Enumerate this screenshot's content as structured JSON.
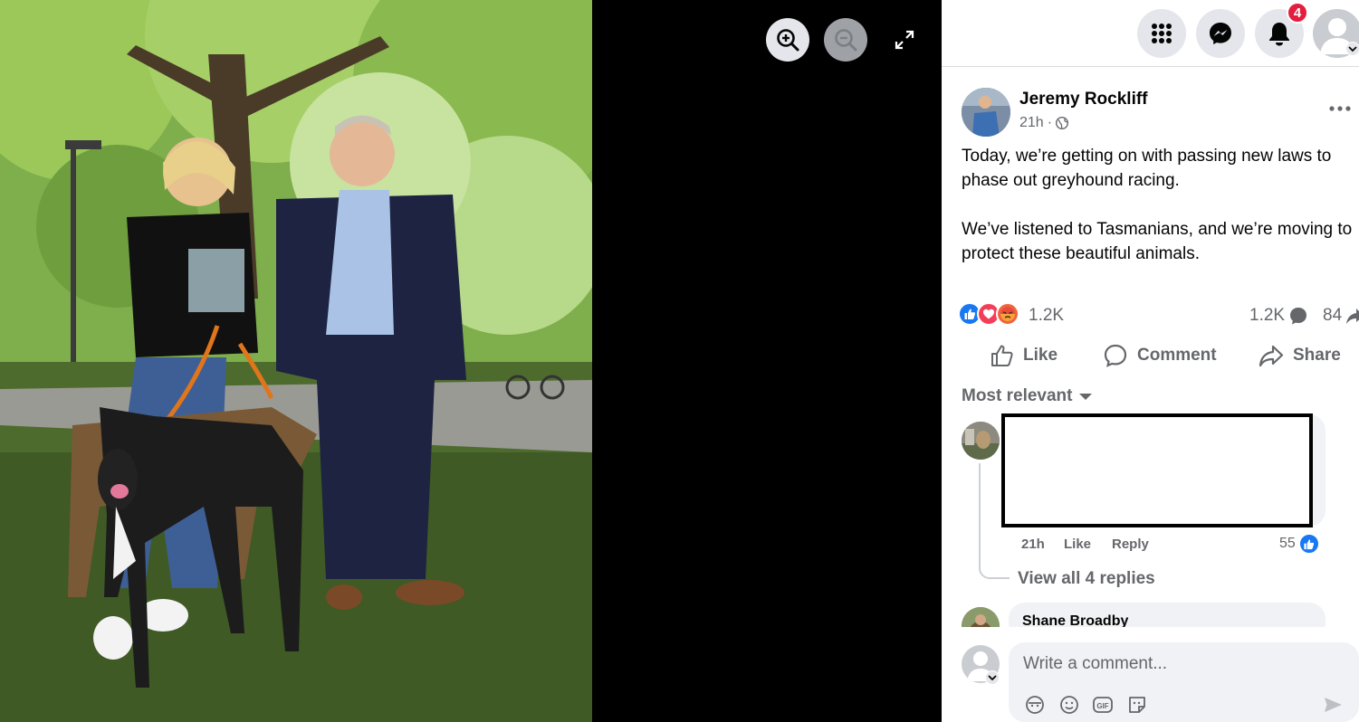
{
  "viewer": {
    "zoom_in_icon": "zoom-in-icon",
    "zoom_out_icon": "zoom-out-icon",
    "fullscreen_icon": "fullscreen-icon"
  },
  "topbar": {
    "notifications_count": "4"
  },
  "post": {
    "author": "Jeremy Rockliff",
    "time": "21h",
    "audience_icon": "globe-icon",
    "text_p1": "Today, we’re getting on with passing new laws to phase out greyhound racing.",
    "text_p2": "We’ve listened to Tasmanians, and we’re moving to protect these beautiful animals.",
    "reactions": [
      "like",
      "love",
      "angry"
    ],
    "reaction_count": "1.2K",
    "comment_count": "1.2K",
    "share_count": "84"
  },
  "actions": {
    "like": "Like",
    "comment": "Comment",
    "share": "Share"
  },
  "comments": {
    "sort_label": "Most relevant",
    "first": {
      "time": "21h",
      "like_label": "Like",
      "reply_label": "Reply",
      "like_count": "55",
      "view_replies": "View all 4 replies"
    },
    "second": {
      "author": "Shane Broadby"
    }
  },
  "composer": {
    "placeholder": "Write a comment..."
  },
  "colors": {
    "facebook_blue": "#1877f2",
    "badge_red": "#e41e3f",
    "text_secondary": "#65676b"
  }
}
